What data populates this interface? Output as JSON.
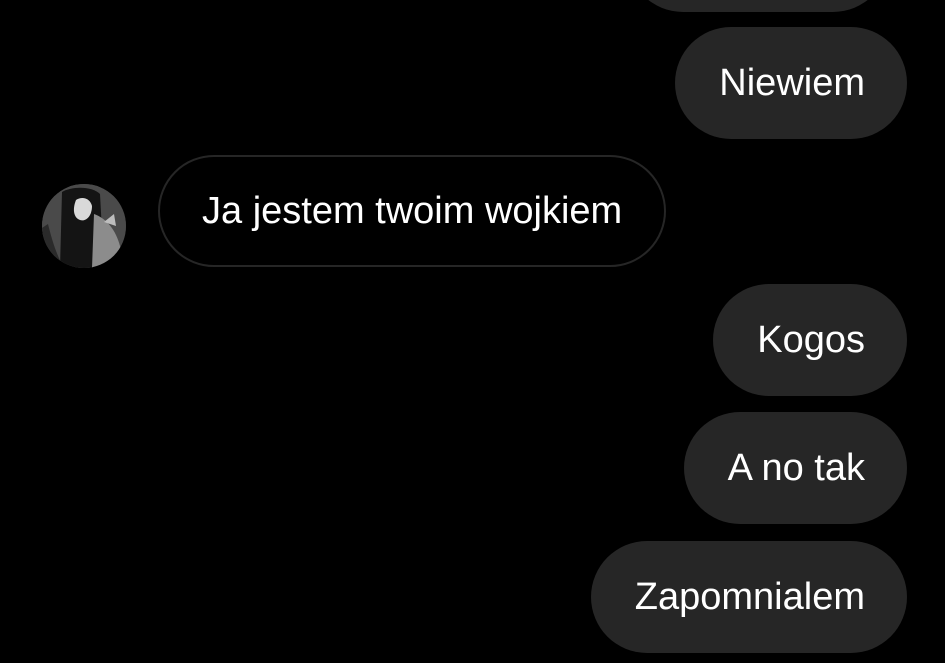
{
  "colors": {
    "background": "#000000",
    "outgoing_bubble": "#262626",
    "incoming_border": "#262626",
    "text": "#ffffff"
  },
  "messages": [
    {
      "direction": "outgoing",
      "text": "Niewiem"
    },
    {
      "direction": "incoming",
      "text": "Ja jestem twoim wojkiem",
      "avatar": "contact-avatar"
    },
    {
      "direction": "outgoing",
      "text": "Kogos"
    },
    {
      "direction": "outgoing",
      "text": "A no tak"
    },
    {
      "direction": "outgoing",
      "text": "Zapomnialem"
    }
  ]
}
